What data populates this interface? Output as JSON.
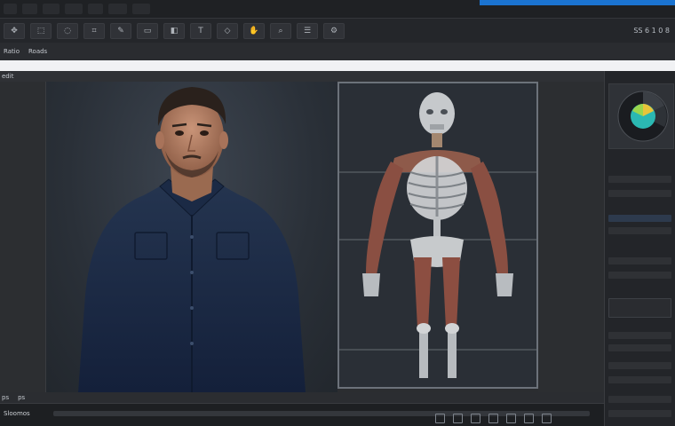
{
  "toolbar": {
    "readout": "SS 6 1 0 8"
  },
  "options": {
    "items": [
      "Ratio",
      "Roads"
    ]
  },
  "document": {
    "tab_label": "edit"
  },
  "status": {
    "items": [
      "ps",
      "ps"
    ]
  },
  "timeline": {
    "label": "Sloomos"
  },
  "colors": {
    "accent": "#1b74d1",
    "chrome_dark": "#1f2124",
    "panel": "#2c2e31",
    "canvas_frame": "#6c727a"
  }
}
